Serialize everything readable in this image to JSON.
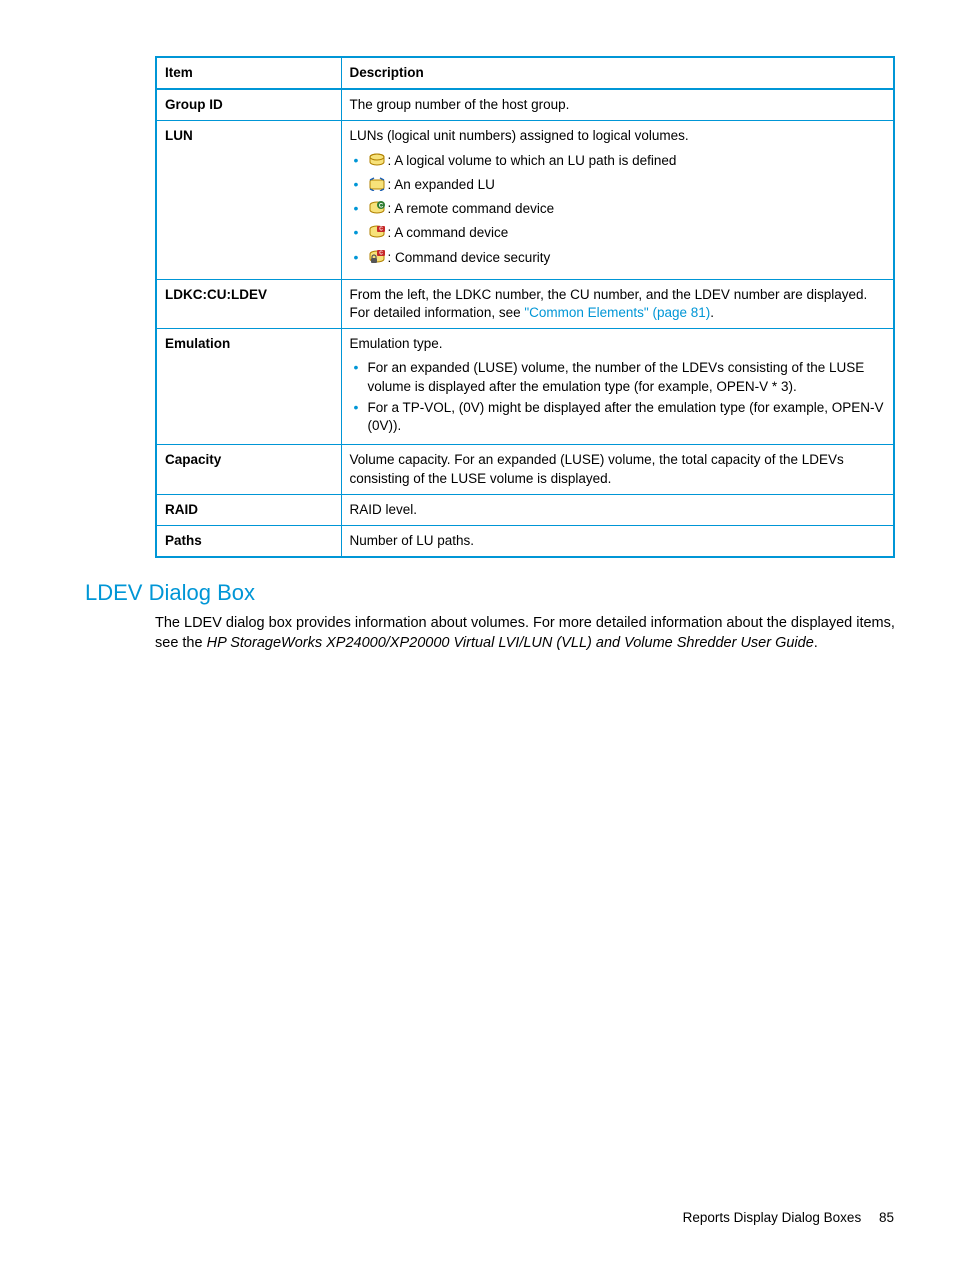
{
  "table": {
    "head": {
      "c1": "Item",
      "c2": "Description"
    },
    "rows": {
      "group_id": {
        "item": "Group ID",
        "desc": "The group number of the host group."
      },
      "lun": {
        "item": "LUN",
        "intro": "LUNs (logical unit numbers) assigned to logical volumes.",
        "icons": [
          {
            "name": "volume-icon",
            "text": ": A logical volume to which an LU path is defined"
          },
          {
            "name": "expanded-lu-icon",
            "text": ": An expanded LU"
          },
          {
            "name": "remote-cmd-dev-icon",
            "text": ": A remote command device"
          },
          {
            "name": "cmd-dev-icon",
            "text": ": A command device"
          },
          {
            "name": "cmd-dev-security-icon",
            "text": ": Command device security"
          }
        ]
      },
      "ldkc": {
        "item": "LDKC:CU:LDEV",
        "desc_pre": "From the left, the LDKC number, the CU number, and the LDEV number are displayed. For detailed information, see ",
        "link": "\"Common Elements\" (page 81)",
        "desc_post": "."
      },
      "emulation": {
        "item": "Emulation",
        "intro": "Emulation type.",
        "bullets": [
          "For an expanded (LUSE) volume, the number of the LDEVs consisting of the LUSE volume is displayed after the emulation type (for example, OPEN-V * 3).",
          "For a TP-VOL, (0V) might be displayed after the emulation type (for example, OPEN-V (0V))."
        ]
      },
      "capacity": {
        "item": "Capacity",
        "desc": "Volume capacity. For an expanded (LUSE) volume, the total capacity of the LDEVs consisting of the LUSE volume is displayed."
      },
      "raid": {
        "item": "RAID",
        "desc": "RAID level."
      },
      "paths": {
        "item": "Paths",
        "desc": "Number of LU paths."
      }
    }
  },
  "section": {
    "heading": "LDEV Dialog Box",
    "para_pre": "The LDEV dialog box provides information about volumes. For more detailed information about the displayed items, see the ",
    "para_italic": "HP StorageWorks XP24000/XP20000 Virtual LVI/LUN (VLL) and Volume Shredder User Guide",
    "para_post": "."
  },
  "footer": {
    "text": "Reports Display Dialog Boxes",
    "page": "85"
  }
}
